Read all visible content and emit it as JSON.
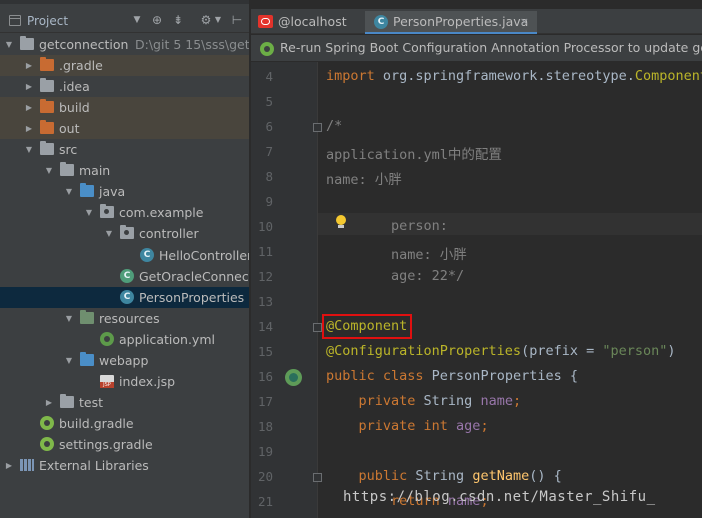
{
  "project_panel": {
    "title": "Project",
    "toolbar_icons": [
      "chevron-down-icon",
      "target-icon",
      "collapse-icon",
      "gear-icon",
      "hide-icon"
    ],
    "tree": [
      {
        "label": "getconnection",
        "path": "D:\\git 5 15\\sss\\getco",
        "arrow": "▼",
        "icon": "folder-gray",
        "depth": 0
      },
      {
        "label": ".gradle",
        "arrow": "▶",
        "icon": "folder-orange",
        "depth": 1,
        "excluded": true
      },
      {
        "label": ".idea",
        "arrow": "▶",
        "icon": "folder-gray",
        "depth": 1
      },
      {
        "label": "build",
        "arrow": "▶",
        "icon": "folder-orange",
        "depth": 1,
        "excluded": true
      },
      {
        "label": "out",
        "arrow": "▶",
        "icon": "folder-orange",
        "depth": 1,
        "excluded": true
      },
      {
        "label": "src",
        "arrow": "▼",
        "icon": "folder-gray",
        "depth": 1
      },
      {
        "label": "main",
        "arrow": "▼",
        "icon": "folder-gray",
        "depth": 2
      },
      {
        "label": "java",
        "arrow": "▼",
        "icon": "folder-blue",
        "depth": 3
      },
      {
        "label": "com.example",
        "arrow": "▼",
        "icon": "package",
        "depth": 4
      },
      {
        "label": "controller",
        "arrow": "▼",
        "icon": "package",
        "depth": 5
      },
      {
        "label": "HelloController",
        "arrow": "",
        "icon": "class",
        "depth": 6
      },
      {
        "label": "GetOracleConnectA",
        "arrow": "",
        "icon": "spring-class",
        "depth": 5
      },
      {
        "label": "PersonProperties",
        "arrow": "",
        "icon": "class",
        "depth": 5,
        "selected": true
      },
      {
        "label": "resources",
        "arrow": "▼",
        "icon": "folder-teal",
        "depth": 3
      },
      {
        "label": "application.yml",
        "arrow": "",
        "icon": "spring",
        "depth": 4
      },
      {
        "label": "webapp",
        "arrow": "▼",
        "icon": "folder-blue",
        "depth": 3
      },
      {
        "label": "index.jsp",
        "arrow": "",
        "icon": "jsp",
        "depth": 4
      },
      {
        "label": "test",
        "arrow": "▶",
        "icon": "folder-gray",
        "depth": 2
      },
      {
        "label": "build.gradle",
        "arrow": "",
        "icon": "gradle",
        "depth": 1
      },
      {
        "label": "settings.gradle",
        "arrow": "",
        "icon": "gradle",
        "depth": 1
      },
      {
        "label": "External Libraries",
        "arrow": "▶",
        "icon": "library",
        "depth": 0
      }
    ]
  },
  "tabs": [
    {
      "label": "@localhost",
      "icon": "oracle-db-icon",
      "active": false
    },
    {
      "label": "PersonProperties.java",
      "icon": "class-icon",
      "active": true,
      "close": "×"
    }
  ],
  "notification": {
    "text": "Re-run Spring Boot Configuration Annotation Processor to update gener"
  },
  "editor": {
    "lines": [
      {
        "n": "4",
        "parts": [
          [
            "kw",
            "import "
          ],
          [
            "",
            "org.springframework.stereotype."
          ],
          [
            "cls",
            "Component"
          ]
        ]
      },
      {
        "n": "5",
        "parts": []
      },
      {
        "n": "6",
        "parts": [
          [
            "cm",
            "/*"
          ]
        ]
      },
      {
        "n": "7",
        "parts": [
          [
            "cm",
            "application.yml中的配置"
          ]
        ]
      },
      {
        "n": "8",
        "parts": [
          [
            "cm",
            "name: 小胖"
          ]
        ]
      },
      {
        "n": "9",
        "parts": []
      },
      {
        "n": "10",
        "parts": [
          [
            "cm",
            "        person:"
          ]
        ]
      },
      {
        "n": "11",
        "parts": [
          [
            "cm",
            "        name: 小胖"
          ]
        ]
      },
      {
        "n": "12",
        "parts": [
          [
            "cm",
            "        age: 22*/"
          ]
        ]
      },
      {
        "n": "13",
        "parts": []
      },
      {
        "n": "14",
        "parts": [
          [
            "ann",
            "@Component"
          ]
        ]
      },
      {
        "n": "15",
        "parts": [
          [
            "ann",
            "@ConfigurationProperties"
          ],
          [
            "",
            "("
          ],
          [
            "",
            "prefix = "
          ],
          [
            "str",
            "\"person\""
          ],
          [
            "",
            ")"
          ]
        ]
      },
      {
        "n": "16",
        "parts": [
          [
            "kw",
            "public class "
          ],
          [
            "",
            "PersonProperties {"
          ]
        ]
      },
      {
        "n": "17",
        "parts": [
          [
            "kw",
            "    private "
          ],
          [
            "",
            "String "
          ],
          [
            "fld",
            "name"
          ],
          [
            "kw",
            ";"
          ]
        ]
      },
      {
        "n": "18",
        "parts": [
          [
            "kw",
            "    private int "
          ],
          [
            "fld",
            "age"
          ],
          [
            "kw",
            ";"
          ]
        ]
      },
      {
        "n": "19",
        "parts": []
      },
      {
        "n": "20",
        "parts": [
          [
            "kw",
            "    public "
          ],
          [
            "",
            "String "
          ],
          [
            "fn",
            "getName"
          ],
          [
            "",
            "() {"
          ]
        ]
      },
      {
        "n": "21",
        "parts": [
          [
            "kw",
            "        return "
          ],
          [
            "fld",
            "name"
          ],
          [
            "kw",
            ";"
          ]
        ]
      }
    ]
  },
  "watermark": "https://blog.csdn.net/Master_Shifu_",
  "colors": {
    "panel_bg": "#3c3f41",
    "editor_bg": "#2b2b2b",
    "selection": "#0d293e",
    "keyword": "#cc7832",
    "annotation": "#bbb529",
    "highlight_box": "#e01010"
  }
}
